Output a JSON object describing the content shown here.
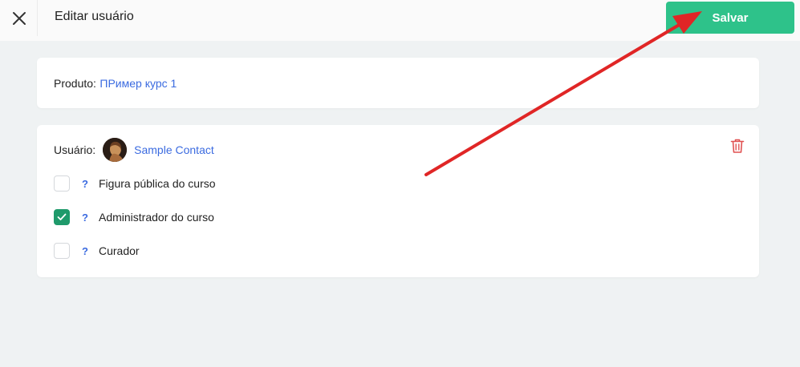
{
  "header": {
    "title": "Editar usuário",
    "save_label": "Salvar"
  },
  "product": {
    "label": "Produto:",
    "name": "ПРимер курс 1"
  },
  "user": {
    "label": "Usuário:",
    "name": "Sample Contact",
    "options": [
      {
        "label": "Figura pública do curso",
        "checked": false,
        "help": "?"
      },
      {
        "label": "Administrador do curso",
        "checked": true,
        "help": "?"
      },
      {
        "label": "Curador",
        "checked": false,
        "help": "?"
      }
    ]
  },
  "colors": {
    "accent": "#2ec28a",
    "checkbox_checked": "#1f9a6b",
    "link": "#3b6be0",
    "danger": "#e05151",
    "annotation_arrow": "#e02626",
    "background": "#eff2f3"
  },
  "icons": {
    "close": "close-icon",
    "delete": "trash-icon",
    "check": "checkmark-icon"
  }
}
